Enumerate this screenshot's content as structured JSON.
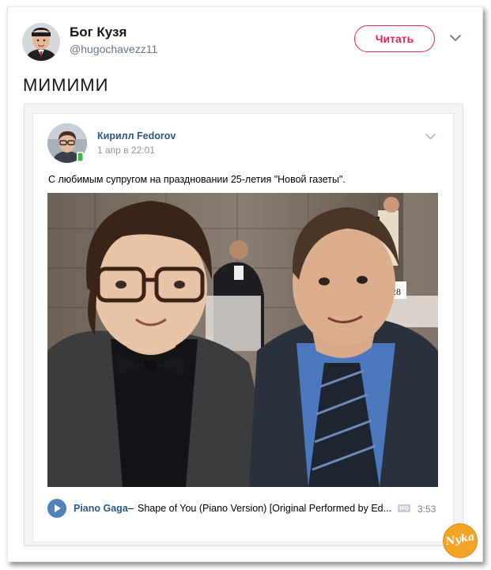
{
  "tweet": {
    "author_name": "Бог Кузя",
    "author_handle": "@hugochavezz11",
    "follow_label": "Читать",
    "text": "МИМИМИ"
  },
  "vk_post": {
    "author_name": "Кирилл Fedorov",
    "date": "1 апр в 22:01",
    "text": "С любимым супругом на праздновании 25-летия \"Новой газеты\".",
    "table_number": "28",
    "audio": {
      "artist": "Piano Gaga",
      "separator": "–",
      "title": "Shape of You (Piano Version) [Original Performed by Ed...",
      "badge": "HQ",
      "duration": "3:53"
    }
  },
  "watermark": {
    "text": "Nyka"
  },
  "icons": {
    "caret": "chevron-down-icon",
    "play": "play-icon",
    "online_mobile": "mobile-online-icon"
  },
  "colors": {
    "follow_accent": "#e0245e",
    "vk_link": "#2a5885",
    "vk_play": "#5181b8"
  }
}
